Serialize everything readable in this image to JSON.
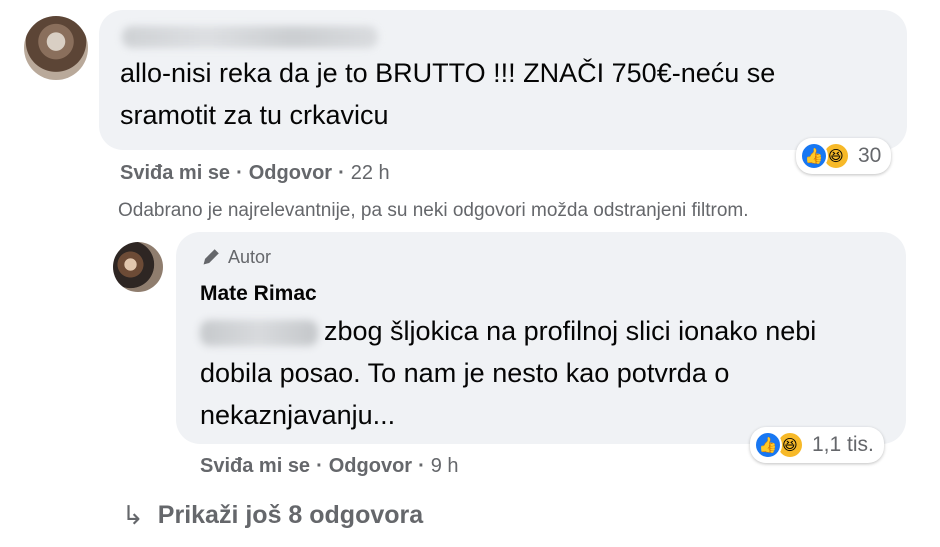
{
  "comment": {
    "text_line1": "allo-nisi reka da je to BRUTTO !!! ZNAČI 750€-neću se",
    "text_line2": "sramotit za tu crkavicu",
    "reactions_count": "30",
    "like_label": "Sviđa mi se",
    "reply_label": "Odgovor",
    "time": "22 h"
  },
  "filter_note": "Odabrano je najrelevantnije, pa su neki odgovori možda odstranjeni filtrom.",
  "reply": {
    "author_badge": "Autor",
    "author_name": "Mate Rimac",
    "text_line1": "zbog šljokica na profilnoj slici ionako nebi",
    "text_line2": "dobila posao. To nam je nesto kao potvrda o",
    "text_line3": "nekaznjavanju...",
    "reactions_count": "1,1 tis.",
    "like_label": "Sviđa mi se",
    "reply_label": "Odgovor",
    "time": "9 h"
  },
  "more_replies": "Prikaži još 8 odgovora",
  "icons": {
    "like": "like-icon",
    "haha": "haha-icon",
    "author": "pencil-icon",
    "more": "reply-arrow-icon"
  },
  "colors": {
    "bubble": "#f0f2f5",
    "meta_text": "#65676b",
    "like_blue": "#1877f2",
    "haha_yellow": "#f7b928"
  }
}
